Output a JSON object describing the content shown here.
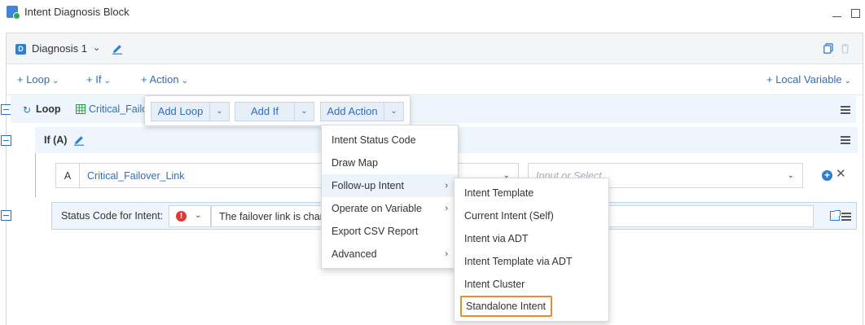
{
  "window": {
    "title": "Intent Diagnosis Block"
  },
  "header": {
    "title": "Diagnosis 1",
    "badge": "D"
  },
  "toolbar": {
    "loop": "+ Loop",
    "if": "+ If",
    "action": "+ Action",
    "local_variable": "+ Local Variable"
  },
  "loop": {
    "label": "Loop",
    "variable": "Critical_Failover_Link"
  },
  "if_block": {
    "label": "If (A)"
  },
  "condition": {
    "letter": "A",
    "field": "Critical_Failover_Link",
    "placeholder": "Input or Select..."
  },
  "status": {
    "label": "Status Code for Intent:",
    "message": "The failover link is changed"
  },
  "add_popup": {
    "add_loop": "Add Loop",
    "add_if": "Add If",
    "add_action": "Add Action"
  },
  "action_menu": {
    "items": [
      {
        "label": "Intent Status Code",
        "submenu": false
      },
      {
        "label": "Draw Map",
        "submenu": false
      },
      {
        "label": "Follow-up Intent",
        "submenu": true
      },
      {
        "label": "Operate on Variable",
        "submenu": true
      },
      {
        "label": "Export CSV Report",
        "submenu": false
      },
      {
        "label": "Advanced",
        "submenu": true
      }
    ]
  },
  "followup_menu": {
    "items": [
      "Intent Template",
      "Current Intent (Self)",
      "Intent via ADT",
      "Intent Template via ADT",
      "Intent Cluster",
      "Standalone Intent"
    ]
  },
  "colors": {
    "accent": "#2f6fb8",
    "highlight_border": "#f08a30",
    "error": "#dd3a3a"
  }
}
